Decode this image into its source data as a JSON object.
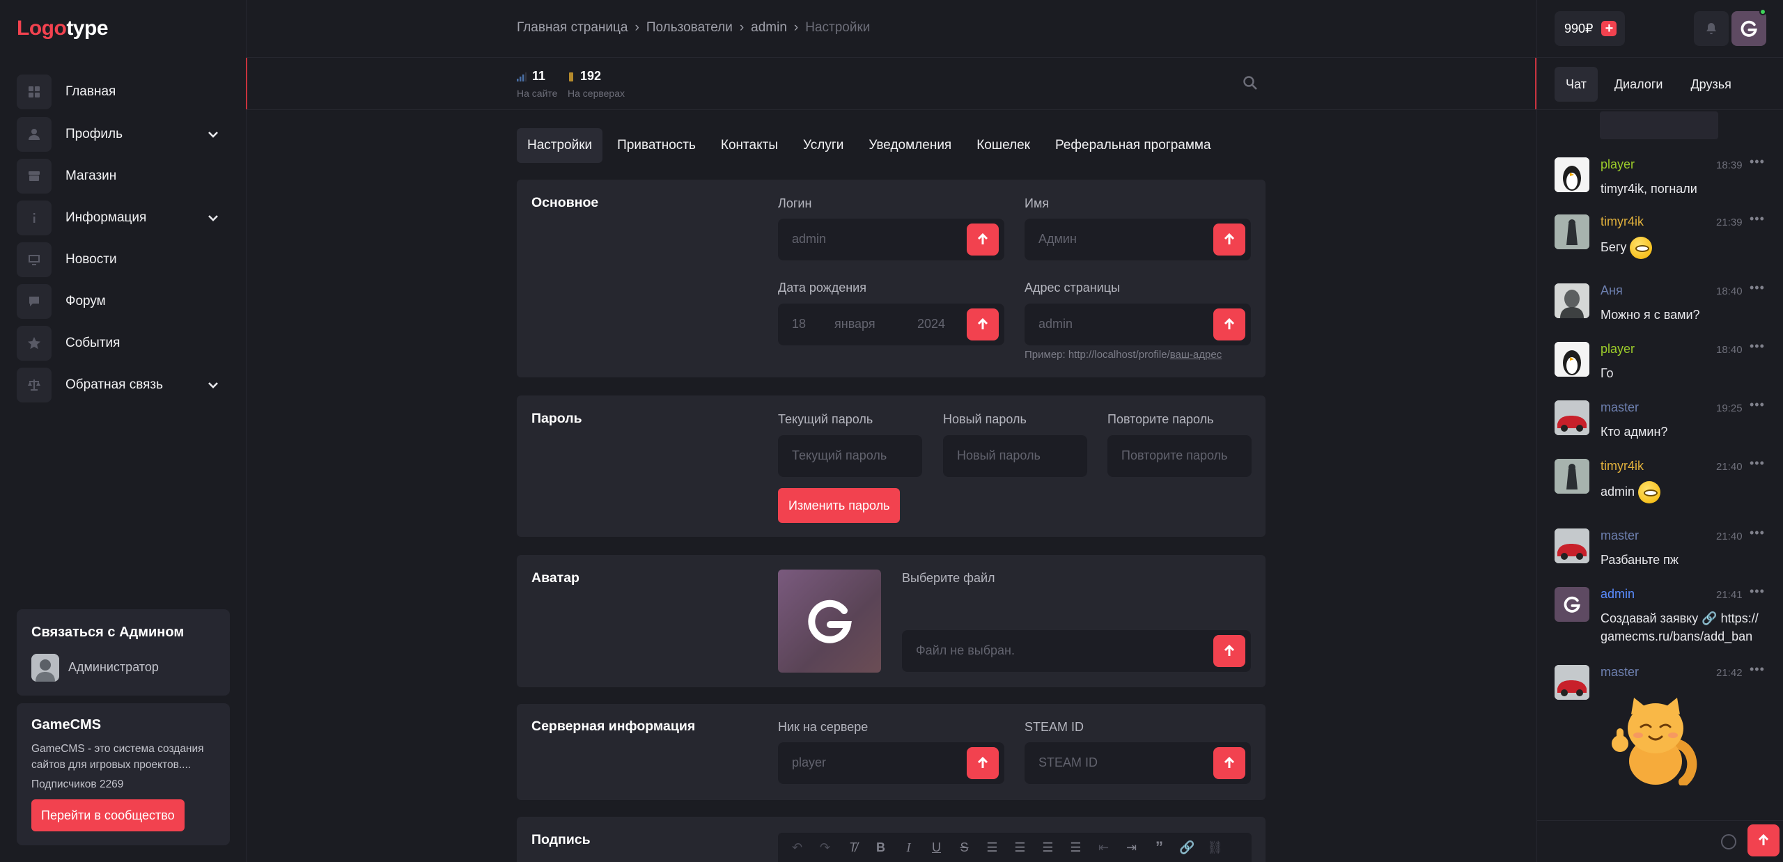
{
  "logo": {
    "part1": "Logo",
    "part2": "type"
  },
  "sidebar": {
    "items": [
      {
        "label": "Главная",
        "icon": "home-icon",
        "expandable": false
      },
      {
        "label": "Профиль",
        "icon": "user-icon",
        "expandable": true
      },
      {
        "label": "Магазин",
        "icon": "shop-icon",
        "expandable": false
      },
      {
        "label": "Информация",
        "icon": "info-icon",
        "expandable": true
      },
      {
        "label": "Новости",
        "icon": "monitor-icon",
        "expandable": false
      },
      {
        "label": "Форум",
        "icon": "chat-bubble-icon",
        "expandable": false
      },
      {
        "label": "События",
        "icon": "star-icon",
        "expandable": false
      },
      {
        "label": "Обратная связь",
        "icon": "scales-icon",
        "expandable": true
      }
    ],
    "contact": {
      "title": "Связаться с Админом",
      "name": "Администратор"
    },
    "community": {
      "title": "GameCMS",
      "description": "GameCMS - это система создания сайтов для игровых проектов....",
      "subscribers": "Подписчиков 2269",
      "button": "Перейти в сообщество"
    }
  },
  "breadcrumb": {
    "items": [
      "Главная страница",
      "Пользователи",
      "admin"
    ],
    "current": "Настройки",
    "separator": "›"
  },
  "stats": [
    {
      "value": "11",
      "label": "На сайте"
    },
    {
      "value": "192",
      "label": "На серверах"
    }
  ],
  "tabs": [
    "Настройки",
    "Приватность",
    "Контакты",
    "Услуги",
    "Уведомления",
    "Кошелек",
    "Реферальная программа"
  ],
  "basic": {
    "title": "Основное",
    "login_label": "Логин",
    "login_value": "admin",
    "name_label": "Имя",
    "name_placeholder": "Админ",
    "birth_label": "Дата рождения",
    "birth_day": "18",
    "birth_month": "января",
    "birth_year": "2024",
    "address_label": "Адрес страницы",
    "address_value": "admin",
    "address_hint": "Пример: http://localhost/profile/",
    "address_hint_link": "ваш-адрес"
  },
  "password": {
    "title": "Пароль",
    "current_label": "Текущий пароль",
    "current_placeholder": "Текущий пароль",
    "new_label": "Новый пароль",
    "new_placeholder": "Новый пароль",
    "repeat_label": "Повторите пароль",
    "repeat_placeholder": "Повторите пароль",
    "button": "Изменить пароль"
  },
  "avatar": {
    "title": "Аватар",
    "choose_label": "Выберите файл",
    "file_placeholder": "Файл не выбран."
  },
  "server": {
    "title": "Серверная информация",
    "nick_label": "Ник на сервере",
    "nick_value": "player",
    "steam_label": "STEAM ID",
    "steam_placeholder": "STEAM ID"
  },
  "signature": {
    "title": "Подпись"
  },
  "header_right": {
    "balance": "990₽",
    "plus": "+"
  },
  "chat": {
    "tabs": [
      "Чат",
      "Диалоги",
      "Друзья"
    ],
    "messages": [
      {
        "nick": "player",
        "nick_color": "#9ccc2a",
        "time": "18:39",
        "text": "timyr4ik, погнали",
        "emoji": false
      },
      {
        "nick": "timyr4ik",
        "nick_color": "#e0b03c",
        "time": "21:39",
        "text": "Бегу",
        "emoji": true
      },
      {
        "nick": "Аня",
        "nick_color": "#6e80b0",
        "time": "18:40",
        "text": "Можно я с вами?",
        "emoji": false
      },
      {
        "nick": "player",
        "nick_color": "#9ccc2a",
        "time": "18:40",
        "text": "Го",
        "emoji": false
      },
      {
        "nick": "master",
        "nick_color": "#6e80b0",
        "time": "19:25",
        "text": "Кто админ?",
        "emoji": false
      },
      {
        "nick": "timyr4ik",
        "nick_color": "#e0b03c",
        "time": "21:40",
        "text": "admin",
        "emoji": true
      },
      {
        "nick": "master",
        "nick_color": "#6e80b0",
        "time": "21:40",
        "text": "Разбаньте пж",
        "emoji": false
      },
      {
        "nick": "admin",
        "nick_color": "#5a8cff",
        "time": "21:41",
        "text": "Создавай заявку 🔗 https://gamecms.ru/bans/add_ban",
        "emoji": false
      },
      {
        "nick": "master",
        "nick_color": "#6e80b0",
        "time": "21:42",
        "text": "",
        "emoji": false
      }
    ],
    "more": "•••"
  },
  "colors": {
    "accent": "#f2424f",
    "bg": "#1b1c22",
    "panel": "#26272f",
    "online": "#3fd35a"
  }
}
